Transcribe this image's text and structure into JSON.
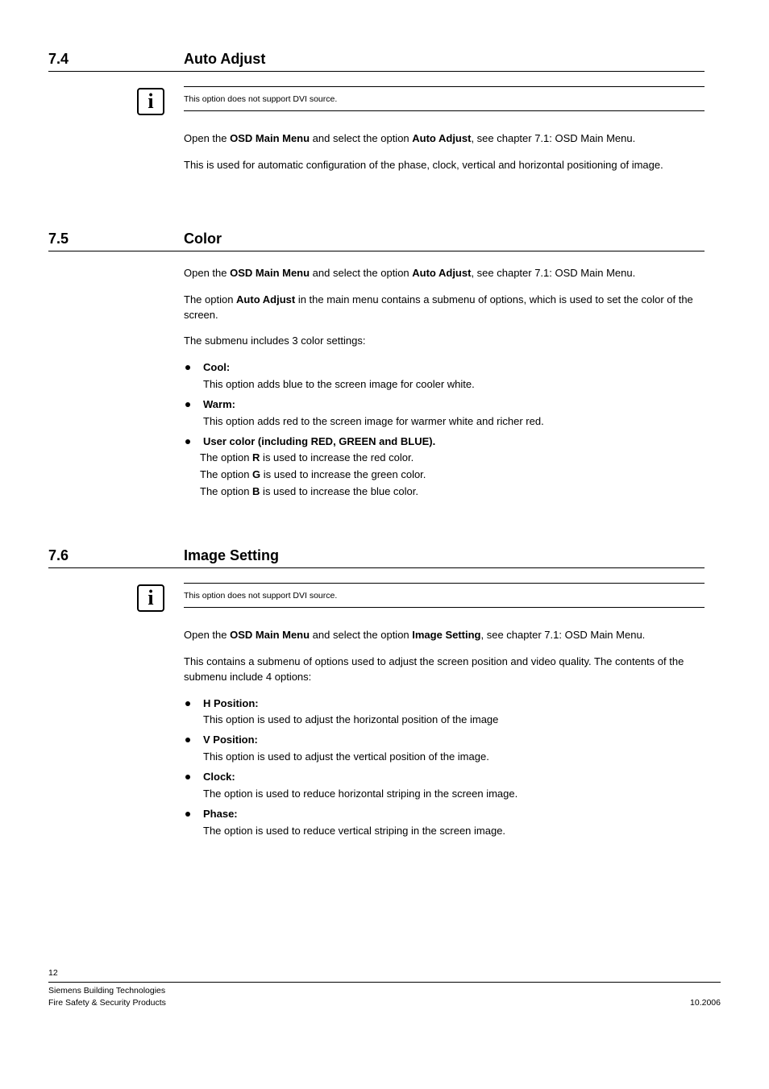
{
  "sections": {
    "autoAdjust": {
      "number": "7.4",
      "title": "Auto Adjust"
    },
    "color": {
      "number": "7.5",
      "title": "Color"
    },
    "imageSetting": {
      "number": "7.6",
      "title": "Image Setting"
    }
  },
  "infoNote": "This option does not support DVI source.",
  "autoAdjust": {
    "open1a": "Open the ",
    "open1b": "OSD Main Menu",
    "open1c": " and select the option ",
    "open1d": "Auto Adjust",
    "open1e": ", see chapter 7.1: OSD Main Menu.",
    "para2": "This is used for automatic configuration of the phase, clock, vertical and horizontal positioning of image."
  },
  "color": {
    "open1a": "Open the ",
    "open1b": "OSD Main Menu",
    "open1c": " and select the option ",
    "open1d": "Auto Adjust",
    "open1e": ", see chapter 7.1: OSD Main Menu.",
    "para2a": "The option ",
    "para2b": "Auto Adjust",
    "para2c": " in the main menu contains a submenu of options, which is used to set the color of the screen.",
    "para3": "The submenu includes 3 color settings:",
    "b1": "Cool:",
    "b1desc": "This option adds blue to the screen image for cooler white.",
    "b2": "Warm:",
    "b2desc": "This option adds red to the screen image for warmer white and richer red.",
    "b3": "User color (including RED, GREEN and BLUE).",
    "opt1a": "The option ",
    "opt1b": "R",
    "opt1c": " is used to increase the red color.",
    "opt2a": "The option ",
    "opt2b": "G",
    "opt2c": " is used to increase the green color.",
    "opt3a": "The option ",
    "opt3b": "B",
    "opt3c": " is used to increase the blue color."
  },
  "imageSetting": {
    "open1a": "Open the ",
    "open1b": "OSD Main Menu",
    "open1c": " and select the option ",
    "open1d": "Image Setting",
    "open1e": ", see chapter 7.1: OSD Main Menu.",
    "para2": "This contains a submenu of options used to adjust the screen position and video quality. The contents of the submenu include 4 options:",
    "b1": "H Position:",
    "b1desc": "This option is used to adjust the horizontal position of the image",
    "b2": "V Position:",
    "b2desc": "This option is used to adjust the vertical position of the image.",
    "b3": "Clock:",
    "b3desc": "The option is used to reduce horizontal striping in the screen image.",
    "b4": "Phase:",
    "b4desc": "The option is used to reduce vertical striping in the screen image."
  },
  "footer": {
    "page": "12",
    "line1": "Siemens Building Technologies",
    "line2left": "Fire Safety & Security Products",
    "line2right": "10.2006"
  }
}
